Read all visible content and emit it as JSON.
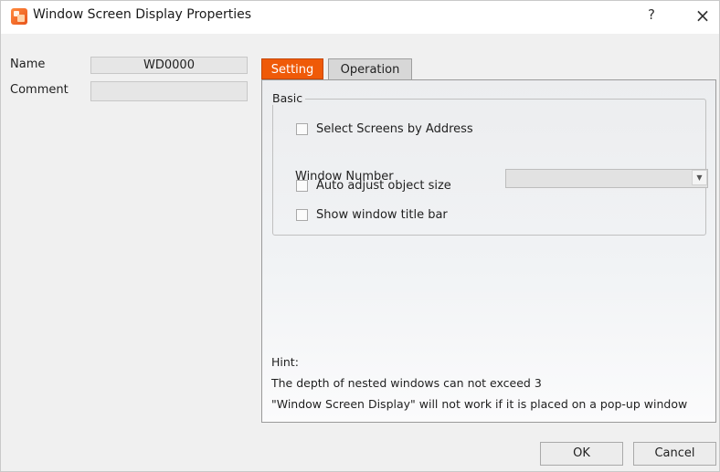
{
  "dialog": {
    "title": "Window Screen Display Properties",
    "help": "?",
    "close": "×"
  },
  "form": {
    "name_label": "Name",
    "name_value": "WD0000",
    "comment_label": "Comment",
    "comment_value": ""
  },
  "tabs": [
    {
      "label": "Setting",
      "active": true
    },
    {
      "label": "Operation",
      "active": false
    }
  ],
  "basic": {
    "group_title": "Basic",
    "select_by_address": {
      "label": "Select Screens by Address",
      "checked": false
    },
    "window_number_label": "Window Number",
    "window_number_value": "",
    "auto_adjust": {
      "label": "Auto adjust object size",
      "checked": false
    },
    "show_title_bar": {
      "label": "Show window title bar",
      "checked": false
    }
  },
  "hint": {
    "title": "Hint:",
    "line1": "The depth of nested windows can not exceed 3",
    "line2": "\"Window Screen Display\" will not work if it is placed on a pop-up window"
  },
  "buttons": {
    "ok": "OK",
    "cancel": "Cancel"
  },
  "colors": {
    "active_tab": "#ef5a08",
    "dialog_bg": "#f0f0f0"
  },
  "icons": {
    "app": "window-display-icon",
    "dropdown": "chevron-down-icon"
  }
}
